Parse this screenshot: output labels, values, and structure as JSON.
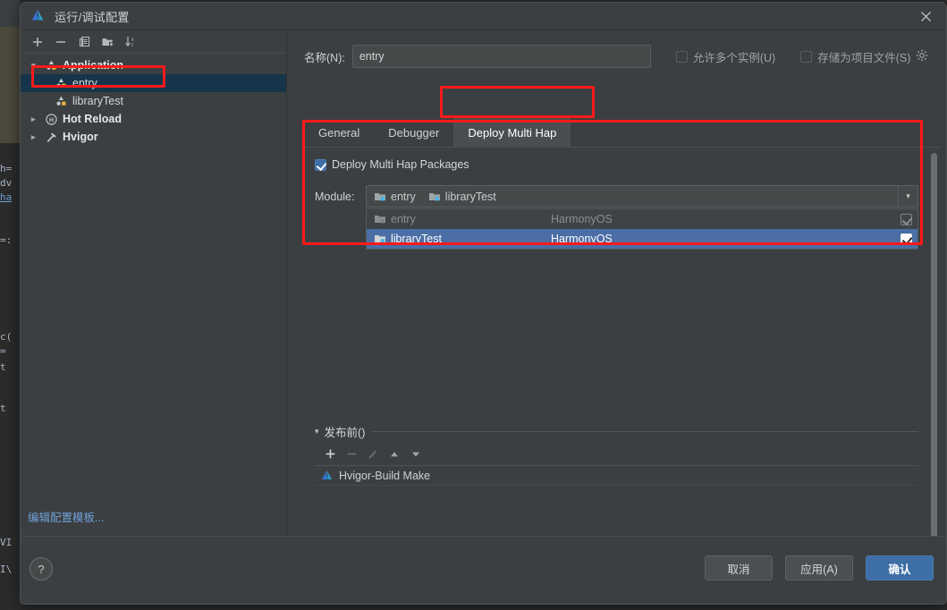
{
  "window": {
    "title": "运行/调试配置",
    "app_logo_icon": "deveco-logo-icon",
    "close_icon": "close-icon"
  },
  "left_panel": {
    "toolbar": [
      {
        "icon": "plus-icon",
        "label": "+"
      },
      {
        "icon": "minus-icon",
        "label": "−"
      },
      {
        "icon": "copy-icon",
        "label": "copy"
      },
      {
        "icon": "folder-add-icon",
        "label": "folder-add"
      },
      {
        "icon": "sort-az-icon",
        "label": "sort"
      }
    ],
    "tree": [
      {
        "label": "Application",
        "icon": "run-config-icon",
        "twisty": "expanded",
        "level": 0,
        "selected": false
      },
      {
        "label": "entry",
        "icon": "run-config-icon",
        "twisty": "none",
        "level": 1,
        "selected": true
      },
      {
        "label": "libraryTest",
        "icon": "run-config-icon",
        "twisty": "none",
        "level": 1,
        "selected": false
      },
      {
        "label": "Hot Reload",
        "icon": "hot-reload-icon",
        "twisty": "collapsed",
        "level": 0,
        "selected": false
      },
      {
        "label": "Hvigor",
        "icon": "hvigor-hammer-icon",
        "twisty": "collapsed",
        "level": 0,
        "selected": false
      }
    ]
  },
  "right_panel": {
    "name_label": "名称(N):",
    "name_value": "entry",
    "name_placeholder": "",
    "allow_multiple_instances": {
      "label": "允许多个实例(U)",
      "checked": false
    },
    "store_as_project_file": {
      "label": "存储为项目文件(S)",
      "checked": false
    },
    "gear_icon": "gear-icon",
    "tabs": [
      {
        "label": "General",
        "active": false
      },
      {
        "label": "Debugger",
        "active": false
      },
      {
        "label": "Deploy Multi Hap",
        "active": true
      }
    ],
    "deploy": {
      "checkbox_label": "Deploy Multi Hap Packages",
      "checkbox_checked": true,
      "module_label": "Module:",
      "module_selected_chips": [
        "entry",
        "libraryTest"
      ],
      "dropdown_arrow_icon": "chevron-down-icon",
      "popup_rows": [
        {
          "name": "entry",
          "os": "HarmonyOS",
          "checked": true,
          "disabled": true,
          "selected": false
        },
        {
          "name": "libraryTest",
          "os": "HarmonyOS",
          "checked": true,
          "disabled": false,
          "selected": true
        }
      ]
    },
    "before_launch": {
      "title": "发布前()",
      "collapse_icon": "triangle-down-icon",
      "toolbar": [
        {
          "icon": "plus-icon",
          "label": "+",
          "enabled": true
        },
        {
          "icon": "minus-icon",
          "label": "−",
          "enabled": false
        },
        {
          "icon": "pencil-icon",
          "label": "edit",
          "enabled": false
        },
        {
          "icon": "arrow-up-icon",
          "label": "▲",
          "enabled": true
        },
        {
          "icon": "arrow-down-icon",
          "label": "▼",
          "enabled": true
        }
      ],
      "items": [
        {
          "label": "Hvigor-Build Make",
          "icon": "deveco-logo-icon"
        }
      ]
    },
    "scrollbar": {
      "icon": "vertical-scrollbar"
    }
  },
  "footer": {
    "edit_templates_link": "编辑配置模板...",
    "help_icon": "help-icon",
    "help_label": "?",
    "buttons": [
      {
        "label": "取消",
        "primary": false
      },
      {
        "label": "应用(A)",
        "primary": false
      },
      {
        "label": "确认",
        "primary": true
      }
    ]
  },
  "background": {
    "code_fragments": [
      "h=",
      "dv",
      "ha",
      "=:",
      "c(",
      "=",
      "t",
      "t",
      "VI",
      "I\\"
    ]
  },
  "colors": {
    "dialog_bg": "#3c3f41",
    "window_bg": "#2b2b2b",
    "accent_blue": "#3d6ea5",
    "selection_navy": "#16354a",
    "popup_selection": "#4a6ea5",
    "annotation_red": "#ff1a1a",
    "link_blue": "#6f9fd8",
    "text_primary": "#d5d8d9",
    "text_secondary": "#9fa3a5"
  },
  "annotations": [
    {
      "name": "entry-tree-item-highlight"
    },
    {
      "name": "deploy-multi-hap-tab-highlight"
    },
    {
      "name": "deploy-section-highlight"
    }
  ]
}
